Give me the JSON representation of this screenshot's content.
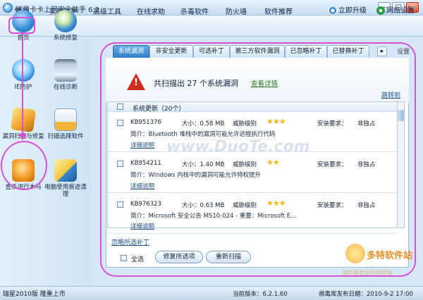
{
  "window": {
    "title": "瑞星卡卡上网安全助手 6.2",
    "min_label": "–",
    "max_label": "□",
    "close_label": "×"
  },
  "menu": {
    "home_label": "常用",
    "items": [
      "实时防护",
      "高级工具",
      "在线求助",
      "杀毒软件",
      "防火墙",
      "软件推荐"
    ],
    "upgrade_label": "立即升级",
    "network_settings_label": "网络设置"
  },
  "sidebar": {
    "items": [
      {
        "label": "首页",
        "icon": "home-icon"
      },
      {
        "label": "系统修复",
        "icon": "system-repair-icon"
      },
      {
        "label": "IE防护",
        "icon": "ie-protection-icon"
      },
      {
        "label": "在线诊断",
        "icon": "online-diagnosis-icon"
      },
      {
        "label": "漏洞扫描与修复",
        "icon": "vulnerability-scan-icon"
      },
      {
        "label": "扫描选择软件",
        "icon": "scan-select-icon"
      },
      {
        "label": "查杀流行木马",
        "icon": "trojan-kill-icon"
      },
      {
        "label": "电脑使用痕迹清理",
        "icon": "trace-clean-icon"
      }
    ]
  },
  "tabs": [
    {
      "label": "系统漏洞",
      "active": true
    },
    {
      "label": "非安全更新",
      "active": false
    },
    {
      "label": "可选补丁",
      "active": false
    },
    {
      "label": "第三方软件漏洞",
      "active": false
    },
    {
      "label": "已忽略补丁",
      "active": false
    },
    {
      "label": "已替换补丁",
      "active": false
    }
  ],
  "tab_arrow": "▸",
  "settings_label": "设置",
  "summary": {
    "text": "共扫描出 27 个系统漏洞",
    "details_link": "查看详情",
    "warn_mark": "!"
  },
  "jump_link": "跳转到",
  "group": {
    "label": "系统更新（20个）"
  },
  "patches": [
    {
      "kb": "KB951376",
      "size": "大小：0.58 MB",
      "risk_label": "威胁级别",
      "stars": "★★★",
      "req_label": "安装要求：",
      "req_value": "非独占",
      "desc": "简介：Bluetooth 堆栈中的漏洞可能允许远程执行代码",
      "link": "详细说明"
    },
    {
      "kb": "KB954211",
      "size": "大小：1.40 MB",
      "risk_label": "威胁级别",
      "stars": "★★",
      "req_label": "安装要求：",
      "req_value": "非独占",
      "desc": "简介：Windows 内核中的漏洞可能允许特权提升",
      "link": "详细说明"
    },
    {
      "kb": "KB976323",
      "size": "大小：0.63 MB",
      "risk_label": "威胁级别",
      "stars": "★★★",
      "req_label": "安装要求：",
      "req_value": "非独占",
      "desc": "简介：Microsoft 安全公告 MS10-024 - 重要：Microsoft E...",
      "link": "详细说明"
    }
  ],
  "ignore_link": "忽略所选补丁",
  "select_all_label": "全选",
  "buttons": {
    "fix": "修复所选项",
    "rescan": "重新扫描"
  },
  "status": {
    "left": "瑞星2010版 隆重上市",
    "version": "当前版本：6.2.1.60",
    "db_date": "病毒库发布日期：2010-9-2 17:00"
  },
  "watermarks": {
    "center": "www.DuoTe.com",
    "brand": "多特软件站",
    "sub": "国内最安全的软件站"
  },
  "colors": {
    "annotation": "#d94fd9",
    "accent": "#2f7ec9",
    "warning": "#d02c1d",
    "star": "#f1b818"
  }
}
